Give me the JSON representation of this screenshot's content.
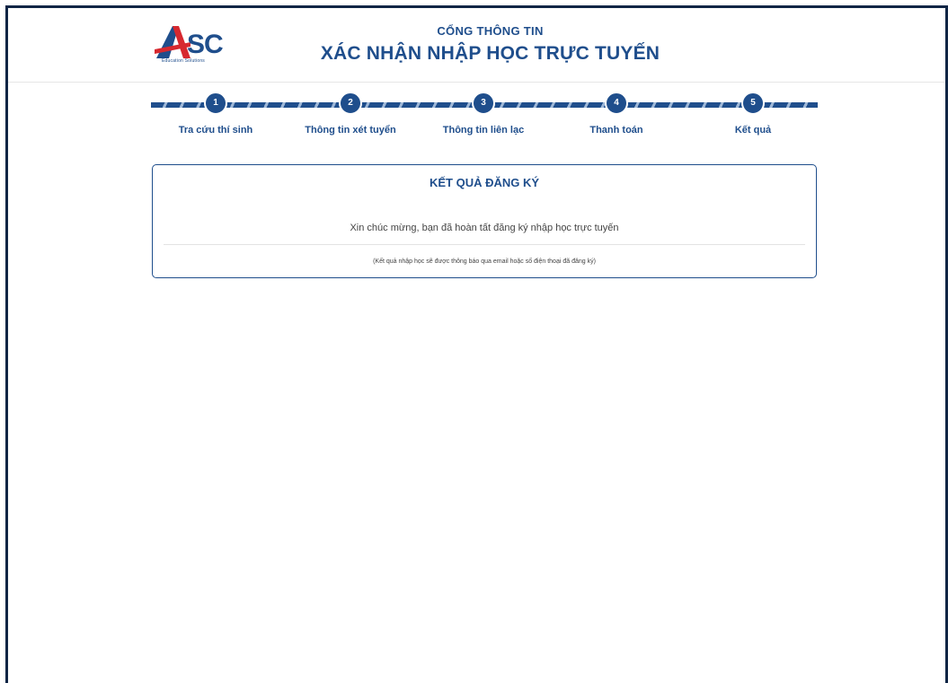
{
  "header": {
    "logo_text": "ASC",
    "logo_subtext": "Education Solutions",
    "portal_subtitle": "CỔNG THÔNG TIN",
    "portal_title": "XÁC NHẬN NHẬP HỌC TRỰC TUYẾN"
  },
  "steps": [
    {
      "number": "1",
      "label": "Tra cứu thí sinh"
    },
    {
      "number": "2",
      "label": "Thông tin xét tuyển"
    },
    {
      "number": "3",
      "label": "Thông tin liên lạc"
    },
    {
      "number": "4",
      "label": "Thanh toán"
    },
    {
      "number": "5",
      "label": "Kết quả"
    }
  ],
  "result": {
    "title": "KẾT QUẢ ĐĂNG KÝ",
    "message": "Xin chúc mừng, bạn đã hoàn tất đăng ký nhập học trực tuyến",
    "note": "(Kết quả nhập học sẽ được thông báo qua email hoặc số điện thoại đã đăng ký)"
  },
  "colors": {
    "primary": "#1f4e8c",
    "accent_red": "#d7282f",
    "frame": "#0f2545"
  }
}
